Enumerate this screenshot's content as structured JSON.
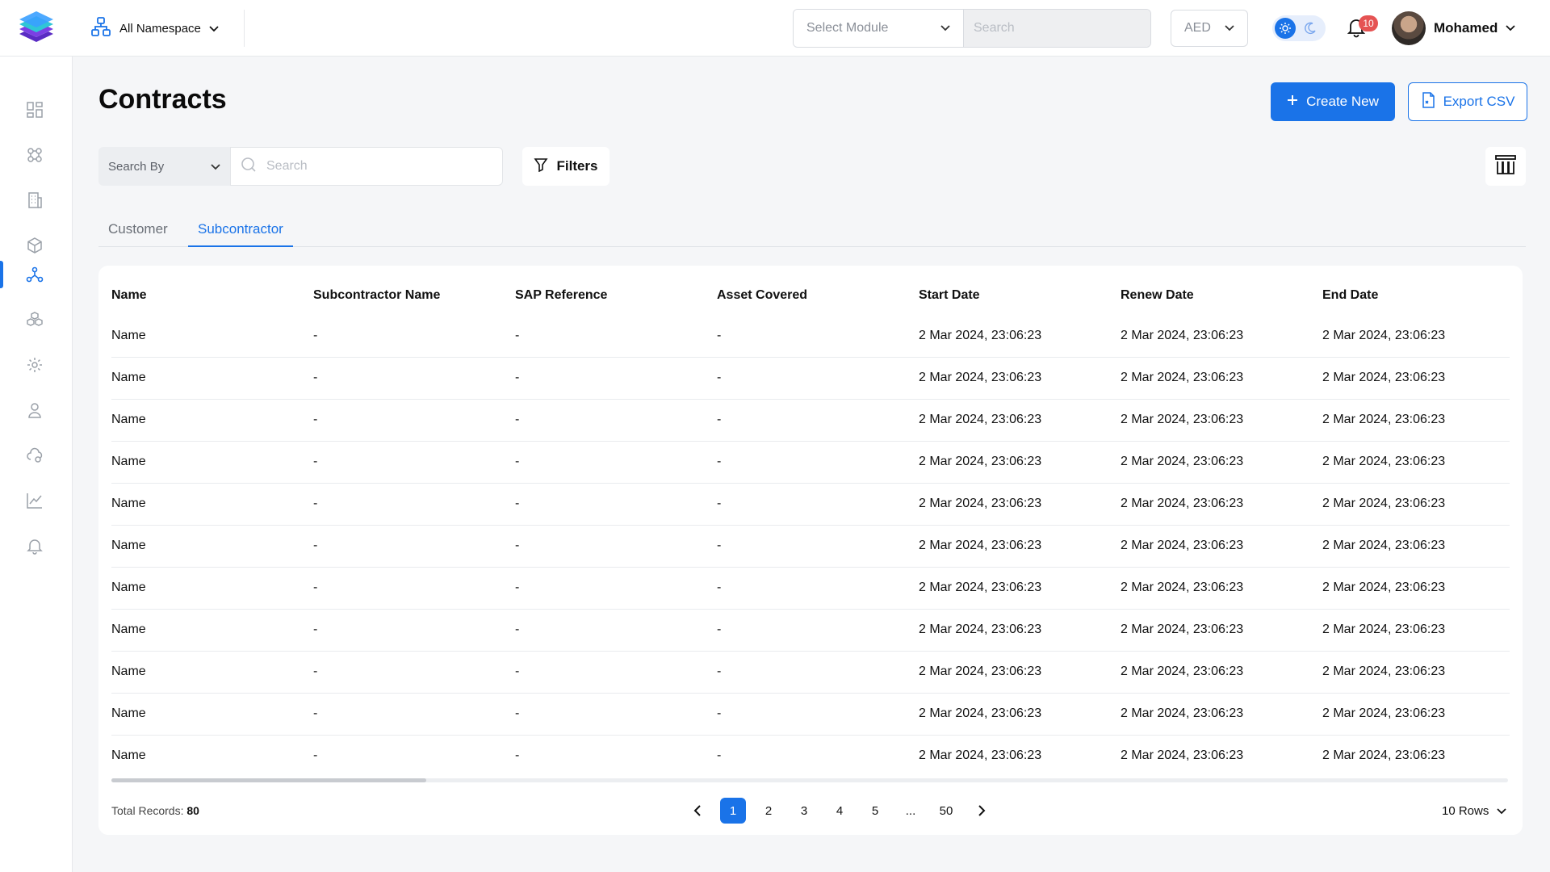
{
  "topbar": {
    "namespace_label": "All Namespace",
    "module_placeholder": "Select Module",
    "search_placeholder": "Search",
    "currency": "AED",
    "notifications_count": "10",
    "user_name": "Mohamed"
  },
  "sidebar": {
    "items": [
      {
        "icon": "dashboard-icon"
      },
      {
        "icon": "modules-icon"
      },
      {
        "icon": "building-icon"
      },
      {
        "icon": "cube-icon"
      },
      {
        "icon": "network-icon",
        "active": true
      },
      {
        "icon": "boxes-icon"
      },
      {
        "icon": "settings-icon"
      },
      {
        "icon": "user-icon"
      },
      {
        "icon": "cloud-settings-icon"
      },
      {
        "icon": "chart-icon"
      },
      {
        "icon": "bell-icon"
      }
    ]
  },
  "page": {
    "title": "Contracts",
    "create_label": "Create New",
    "export_label": "Export CSV"
  },
  "search": {
    "search_by_label": "Search By",
    "placeholder": "Search",
    "filters_label": "Filters"
  },
  "tabs": [
    {
      "label": "Customer",
      "active": false
    },
    {
      "label": "Subcontractor",
      "active": true
    }
  ],
  "table": {
    "columns": [
      "Name",
      "Subcontractor Name",
      "SAP Reference",
      "Asset Covered",
      "Start Date",
      "Renew Date",
      "End Date"
    ],
    "rows": [
      [
        "Name",
        "-",
        "-",
        "-",
        "2 Mar 2024, 23:06:23",
        "2 Mar 2024, 23:06:23",
        "2 Mar 2024, 23:06:23"
      ],
      [
        "Name",
        "-",
        "-",
        "-",
        "2 Mar 2024, 23:06:23",
        "2 Mar 2024, 23:06:23",
        "2 Mar 2024, 23:06:23"
      ],
      [
        "Name",
        "-",
        "-",
        "-",
        "2 Mar 2024, 23:06:23",
        "2 Mar 2024, 23:06:23",
        "2 Mar 2024, 23:06:23"
      ],
      [
        "Name",
        "-",
        "-",
        "-",
        "2 Mar 2024, 23:06:23",
        "2 Mar 2024, 23:06:23",
        "2 Mar 2024, 23:06:23"
      ],
      [
        "Name",
        "-",
        "-",
        "-",
        "2 Mar 2024, 23:06:23",
        "2 Mar 2024, 23:06:23",
        "2 Mar 2024, 23:06:23"
      ],
      [
        "Name",
        "-",
        "-",
        "-",
        "2 Mar 2024, 23:06:23",
        "2 Mar 2024, 23:06:23",
        "2 Mar 2024, 23:06:23"
      ],
      [
        "Name",
        "-",
        "-",
        "-",
        "2 Mar 2024, 23:06:23",
        "2 Mar 2024, 23:06:23",
        "2 Mar 2024, 23:06:23"
      ],
      [
        "Name",
        "-",
        "-",
        "-",
        "2 Mar 2024, 23:06:23",
        "2 Mar 2024, 23:06:23",
        "2 Mar 2024, 23:06:23"
      ],
      [
        "Name",
        "-",
        "-",
        "-",
        "2 Mar 2024, 23:06:23",
        "2 Mar 2024, 23:06:23",
        "2 Mar 2024, 23:06:23"
      ],
      [
        "Name",
        "-",
        "-",
        "-",
        "2 Mar 2024, 23:06:23",
        "2 Mar 2024, 23:06:23",
        "2 Mar 2024, 23:06:23"
      ],
      [
        "Name",
        "-",
        "-",
        "-",
        "2 Mar 2024, 23:06:23",
        "2 Mar 2024, 23:06:23",
        "2 Mar 2024, 23:06:23"
      ]
    ]
  },
  "footer": {
    "total_label": "Total Records:",
    "total_value": "80",
    "pages": [
      "1",
      "2",
      "3",
      "4",
      "5",
      "...",
      "50"
    ],
    "current_page": "1",
    "rows_label": "10 Rows"
  },
  "colors": {
    "accent": "#1a73e8",
    "badge": "#e55353",
    "background": "#f5f6f8"
  }
}
